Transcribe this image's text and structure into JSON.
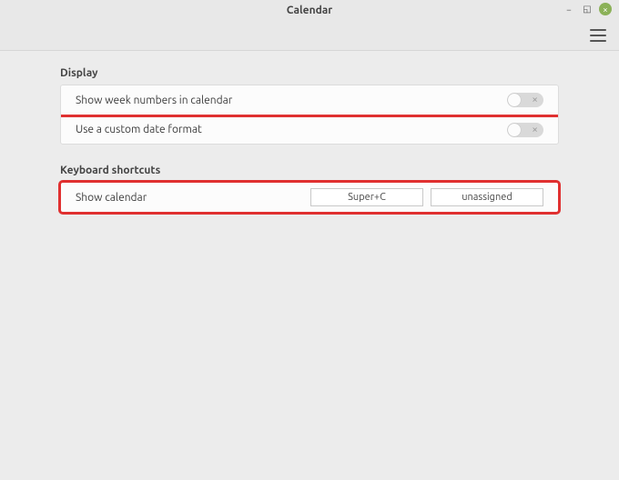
{
  "window": {
    "title": "Calendar"
  },
  "sections": {
    "display": {
      "title": "Display",
      "rows": [
        {
          "label": "Show week numbers in calendar",
          "value": false
        },
        {
          "label": "Use a custom date format",
          "value": false
        }
      ]
    },
    "keyboard": {
      "title": "Keyboard shortcuts",
      "rows": [
        {
          "label": "Show calendar",
          "binding1": "Super+C",
          "binding2": "unassigned"
        }
      ]
    }
  }
}
